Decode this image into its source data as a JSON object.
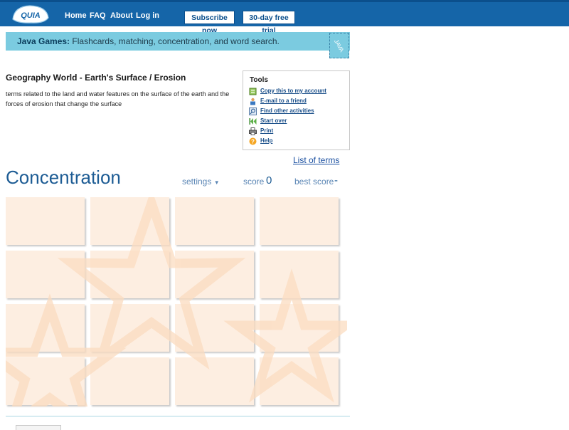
{
  "header": {
    "logo_text": "QUIA",
    "nav": [
      "Home",
      "FAQ",
      "About",
      "Log in"
    ],
    "subscribe_label": "Subscribe now",
    "trial_label": "30-day free trial"
  },
  "banner": {
    "bold": "Java Games:",
    "text": " Flashcards, matching, concentration, and word search.",
    "icon_text": "JAVA"
  },
  "activity": {
    "title": "Geography World - Earth's Surface / Erosion",
    "description": "terms related to the land and water features on the surface of the earth and the forces of erosion that change the surface"
  },
  "tools": {
    "heading": "Tools",
    "items": [
      {
        "label": "Copy this to my account",
        "icon": "copy-icon"
      },
      {
        "label": "E-mail to a friend",
        "icon": "email-icon"
      },
      {
        "label": "Find other activities",
        "icon": "search-icon"
      },
      {
        "label": "Start over",
        "icon": "rewind-icon"
      },
      {
        "label": "Print",
        "icon": "print-icon"
      },
      {
        "label": "Help",
        "icon": "help-icon"
      }
    ]
  },
  "game": {
    "list_terms": "List of terms",
    "name": "Concentration",
    "settings_label": "settings",
    "score_label": "score",
    "score_value": "0",
    "best_label": "best score",
    "best_value": "-",
    "card_count": 16
  },
  "colors": {
    "header_bg": "#1565a8",
    "banner_bg": "#7bcbe0",
    "card_bg": "#fdeee1",
    "title_blue": "#1d5c94"
  }
}
